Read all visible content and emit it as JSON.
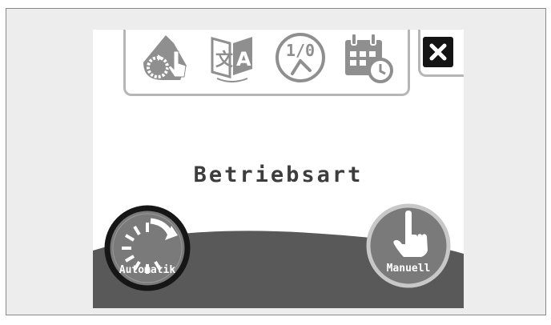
{
  "screen": {
    "title": "Betriebsart"
  },
  "toolbar": {
    "items": [
      {
        "icon": "operating-mode-icon"
      },
      {
        "icon": "language-icon"
      },
      {
        "icon": "on-off-icon",
        "text": "1/0"
      },
      {
        "icon": "schedule-icon"
      }
    ]
  },
  "close_button": {
    "icon": "close-icon"
  },
  "modes": {
    "automatic": {
      "label": "Automatik",
      "selected": true
    },
    "manual": {
      "label": "Manuell",
      "selected": false
    }
  },
  "colors": {
    "icon_gray": "#8f8f8f",
    "dark_ground": "#595959",
    "button_fill": "#7a7a7a",
    "selected_ring": "#161616",
    "unselected_ring": "#c8c8c8"
  }
}
